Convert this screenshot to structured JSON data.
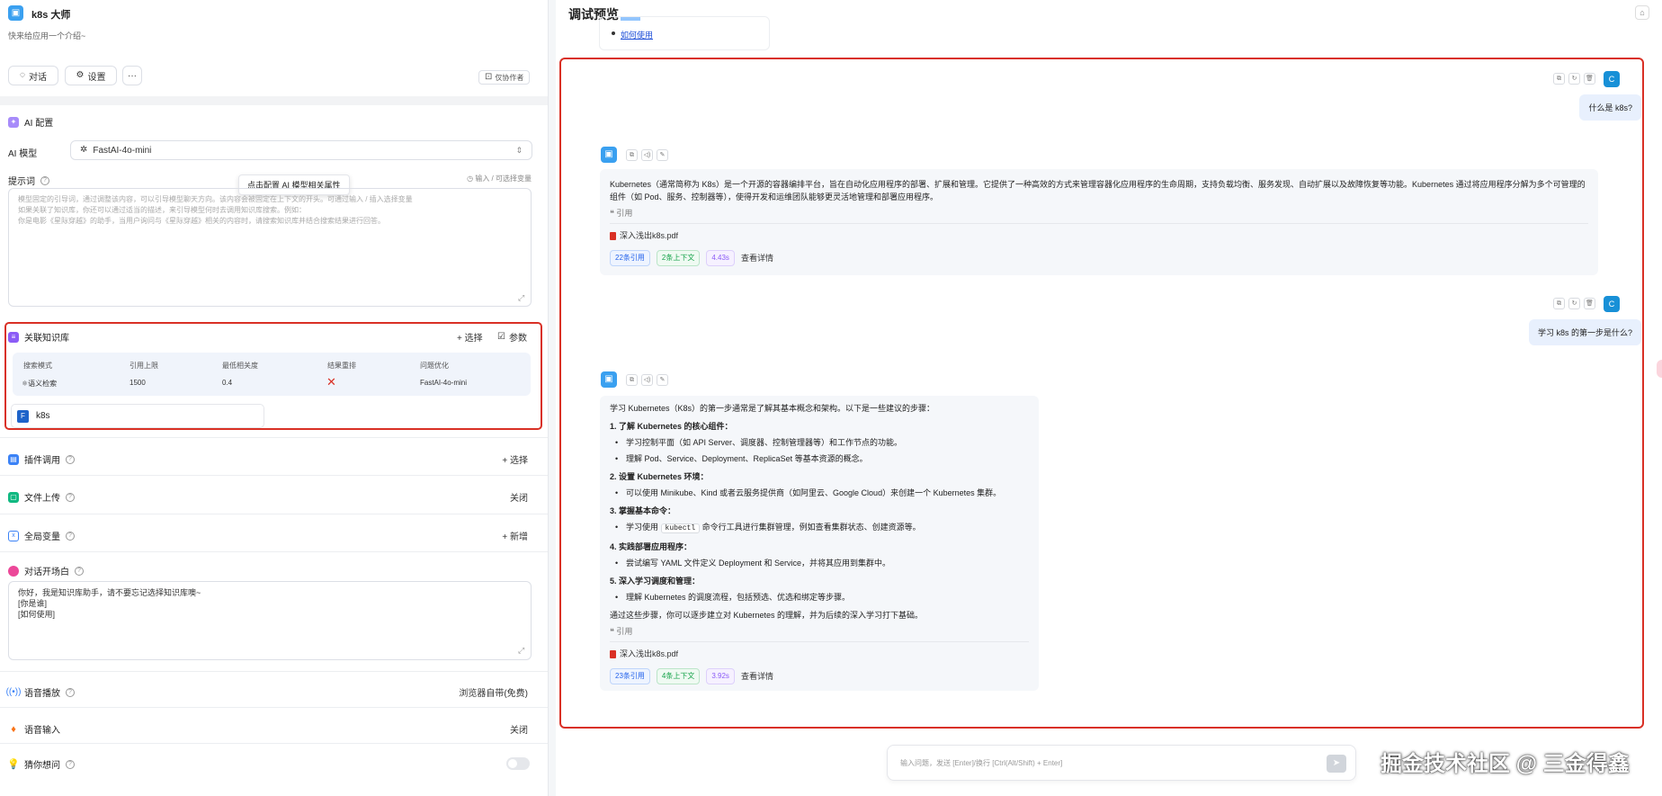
{
  "app": {
    "title": "k8s 大师",
    "intro": "快来给应用一个介绍~",
    "chat_btn": "对话",
    "settings_btn": "设置",
    "more_btn": "···",
    "collab_btn": "仅协作者"
  },
  "ai_config": {
    "section_title": "AI 配置",
    "model_label": "AI 模型",
    "model_value": "FastAI-4o-mini",
    "prompt_label": "提示词",
    "prompt_hint": "输入 / 可选择变量",
    "tooltip": "点击配置 AI 模型相关属性",
    "prompt_placeholder_lines": [
      "模型固定的引导词，通过调整该内容，可以引导模型聊天方向。该内容会被固定在上下文的开头。可通过输入 / 插入选择变量",
      "如果关联了知识库，你还可以通过适当的描述，来引导模型何时去调用知识库搜索。例如：",
      "你是电影《星际穿越》的助手，当用户询问与《星际穿越》相关的内容时，请搜索知识库并结合搜索结果进行回答。"
    ]
  },
  "knowledge": {
    "section_title": "关联知识库",
    "select_btn": "+ 选择",
    "params_btn": "参数",
    "headers": [
      "搜索模式",
      "引用上限",
      "最低相关度",
      "结果重排",
      "问题优化"
    ],
    "row": [
      "语义检索",
      "1500",
      "0.4",
      "✕",
      "FastAI-4o-mini"
    ],
    "kb_name": "k8s"
  },
  "rows": {
    "plugin": {
      "label": "插件调用",
      "value": "+ 选择"
    },
    "file_upload": {
      "label": "文件上传",
      "value": "关闭"
    },
    "variables": {
      "label": "全局变量",
      "value": "+ 新增"
    },
    "opening": {
      "label": "对话开场白"
    },
    "tts": {
      "label": "语音播放",
      "value": "浏览器自带(免费)"
    },
    "voice_input": {
      "label": "语音输入",
      "value": "关闭"
    },
    "guess": {
      "label": "猜你想问"
    }
  },
  "opening_lines": [
    "你好，我是知识库助手，请不要忘记选择知识库噢~",
    "[你是谁]",
    "[如何使用]"
  ],
  "preview": {
    "title": "调试预览",
    "top_link": "如何使用",
    "user_avatar": "C",
    "q1": "什么是 k8s?",
    "a1": "Kubernetes（通常简称为 K8s）是一个开源的容器编排平台，旨在自动化应用程序的部署、扩展和管理。它提供了一种高效的方式来管理容器化应用程序的生命周期，支持负载均衡、服务发现、自动扩展以及故障恢复等功能。Kubernetes 通过将应用程序分解为多个可管理的组件（如 Pod、服务、控制器等），使得开发和运维团队能够更灵活地管理和部署应用程序。",
    "quote_label": "引用",
    "file_name": "深入浅出k8s.pdf",
    "a1_tags": [
      "22条引用",
      "2条上下文",
      "4.43s"
    ],
    "detail_label": "查看详情",
    "q2": "学习 k8s 的第一步是什么?",
    "a2_intro": "学习 Kubernetes（K8s）的第一步通常是了解其基本概念和架构。以下是一些建议的步骤：",
    "a2_steps": [
      {
        "title": "1. 了解 Kubernetes 的核心组件：",
        "items": [
          "学习控制平面（如 API Server、调度器、控制管理器等）和工作节点的功能。",
          "理解 Pod、Service、Deployment、ReplicaSet 等基本资源的概念。"
        ]
      },
      {
        "title": "2. 设置 Kubernetes 环境：",
        "items": [
          "可以使用 Minikube、Kind 或者云服务提供商（如阿里云、Google Cloud）来创建一个 Kubernetes 集群。"
        ]
      },
      {
        "title": "3. 掌握基本命令：",
        "items": []
      },
      {
        "title": "4. 实践部署应用程序：",
        "items": [
          "尝试编写 YAML 文件定义 Deployment 和 Service，并将其应用到集群中。"
        ]
      },
      {
        "title": "5. 深入学习调度和管理：",
        "items": [
          "理解 Kubernetes 的调度流程，包括预选、优选和绑定等步骤。"
        ]
      }
    ],
    "a2_step3_pre": "学习使用",
    "a2_step3_code": "kubectl",
    "a2_step3_post": "命令行工具进行集群管理，例如查看集群状态、创建资源等。",
    "a2_outro": "通过这些步骤，你可以逐步建立对 Kubernetes 的理解，并为后续的深入学习打下基础。",
    "a2_tags": [
      "23条引用",
      "4条上下文",
      "3.92s"
    ],
    "input_placeholder": "输入问题，发送 [Enter]/换行 [Ctrl(Alt/Shift) + Enter]"
  },
  "watermark": "掘金技术社区 @ 三金得鑫",
  "colors": {
    "accent": "#1890d7",
    "highlight": "#d93025"
  }
}
